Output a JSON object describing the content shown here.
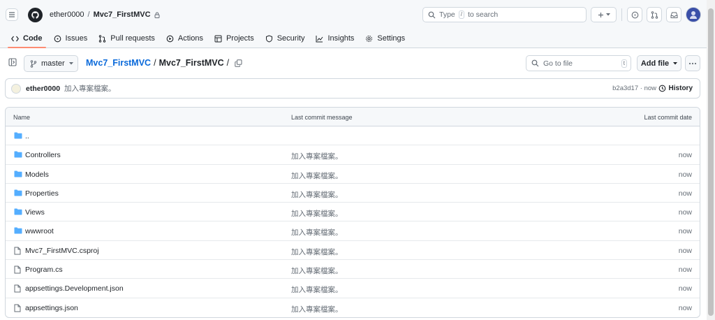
{
  "header": {
    "owner": "ether0000",
    "separator": "/",
    "repo": "Mvc7_FirstMVC",
    "search_prefix": "Type",
    "search_key": "/",
    "search_suffix": "to search"
  },
  "tabs": [
    {
      "label": "Code",
      "icon": "code-icon",
      "active": true
    },
    {
      "label": "Issues",
      "icon": "issue-icon"
    },
    {
      "label": "Pull requests",
      "icon": "pull-request-icon"
    },
    {
      "label": "Actions",
      "icon": "play-icon"
    },
    {
      "label": "Projects",
      "icon": "table-icon"
    },
    {
      "label": "Security",
      "icon": "shield-icon"
    },
    {
      "label": "Insights",
      "icon": "graph-icon"
    },
    {
      "label": "Settings",
      "icon": "gear-icon"
    }
  ],
  "repobar": {
    "branch": "master",
    "path_link": "Mvc7_FirstMVC",
    "path_sep1": "/",
    "path_current": "Mvc7_FirstMVC",
    "path_sep2": "/",
    "goto_placeholder": "Go to file",
    "goto_key": "t",
    "add_file": "Add file"
  },
  "commit": {
    "user": "ether0000",
    "message": "加入專案檔案。",
    "hash_time": "b2a3d17 · now",
    "history": "History"
  },
  "table": {
    "col_name": "Name",
    "col_message": "Last commit message",
    "col_date": "Last commit date",
    "rows": [
      {
        "name": "..",
        "type": "parent",
        "message": "",
        "date": ""
      },
      {
        "name": "Controllers",
        "type": "folder",
        "message": "加入專案檔案。",
        "date": "now"
      },
      {
        "name": "Models",
        "type": "folder",
        "message": "加入專案檔案。",
        "date": "now"
      },
      {
        "name": "Properties",
        "type": "folder",
        "message": "加入專案檔案。",
        "date": "now"
      },
      {
        "name": "Views",
        "type": "folder",
        "message": "加入專案檔案。",
        "date": "now"
      },
      {
        "name": "wwwroot",
        "type": "folder",
        "message": "加入專案檔案。",
        "date": "now"
      },
      {
        "name": "Mvc7_FirstMVC.csproj",
        "type": "file",
        "message": "加入專案檔案。",
        "date": "now"
      },
      {
        "name": "Program.cs",
        "type": "file",
        "message": "加入專案檔案。",
        "date": "now"
      },
      {
        "name": "appsettings.Development.json",
        "type": "file",
        "message": "加入專案檔案。",
        "date": "now"
      },
      {
        "name": "appsettings.json",
        "type": "file",
        "message": "加入專案檔案。",
        "date": "now"
      }
    ]
  },
  "colors": {
    "link": "#0969da",
    "folder": "#54aeff",
    "active_tab": "#fd8c73",
    "border": "#d0d7de",
    "muted": "#656d76"
  }
}
